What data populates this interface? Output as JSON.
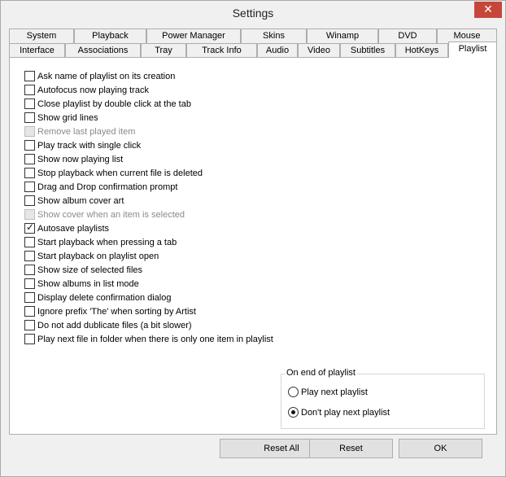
{
  "window": {
    "title": "Settings",
    "close_glyph": "✕"
  },
  "tabs_back": [
    "System",
    "Playback",
    "Power Manager",
    "Skins",
    "Winamp",
    "DVD",
    "Mouse"
  ],
  "tabs_front": [
    "Interface",
    "Associations",
    "Tray",
    "Track Info",
    "Audio",
    "Video",
    "Subtitles",
    "HotKeys",
    "Playlist"
  ],
  "active_tab": "Playlist",
  "options": [
    {
      "label": "Ask name of playlist on its creation",
      "checked": false,
      "disabled": false
    },
    {
      "label": "Autofocus now playing track",
      "checked": false,
      "disabled": false
    },
    {
      "label": "Close playlist by double click at the tab",
      "checked": false,
      "disabled": false
    },
    {
      "label": "Show grid lines",
      "checked": false,
      "disabled": false
    },
    {
      "label": "Remove last played item",
      "checked": false,
      "disabled": true
    },
    {
      "label": "Play track with single click",
      "checked": false,
      "disabled": false
    },
    {
      "label": "Show now playing list",
      "checked": false,
      "disabled": false
    },
    {
      "label": "Stop playback when current file is deleted",
      "checked": false,
      "disabled": false
    },
    {
      "label": "Drag and Drop confirmation prompt",
      "checked": false,
      "disabled": false
    },
    {
      "label": "Show album cover art",
      "checked": false,
      "disabled": false
    },
    {
      "label": "Show cover when an item is selected",
      "checked": false,
      "disabled": true
    },
    {
      "label": "Autosave playlists",
      "checked": true,
      "disabled": false
    },
    {
      "label": "Start playback when pressing a tab",
      "checked": false,
      "disabled": false
    },
    {
      "label": "Start playback on playlist open",
      "checked": false,
      "disabled": false
    },
    {
      "label": "Show size of selected files",
      "checked": false,
      "disabled": false
    },
    {
      "label": "Show albums in list mode",
      "checked": false,
      "disabled": false
    },
    {
      "label": "Display delete confirmation dialog",
      "checked": false,
      "disabled": false
    },
    {
      "label": "Ignore prefix 'The' when sorting by Artist",
      "checked": false,
      "disabled": false
    },
    {
      "label": "Do not add dublicate files (a bit slower)",
      "checked": false,
      "disabled": false
    },
    {
      "label": "Play next file in folder when there is only one item in playlist",
      "checked": false,
      "disabled": false
    }
  ],
  "end_of_playlist": {
    "legend": "On end of playlist",
    "options": [
      {
        "label": "Play next playlist",
        "selected": false
      },
      {
        "label": "Don't play next playlist",
        "selected": true
      }
    ]
  },
  "buttons": {
    "reset_all": "Reset All",
    "reset": "Reset",
    "ok": "OK"
  },
  "icons": {
    "check": "checkmark-icon",
    "close": "close-icon"
  }
}
